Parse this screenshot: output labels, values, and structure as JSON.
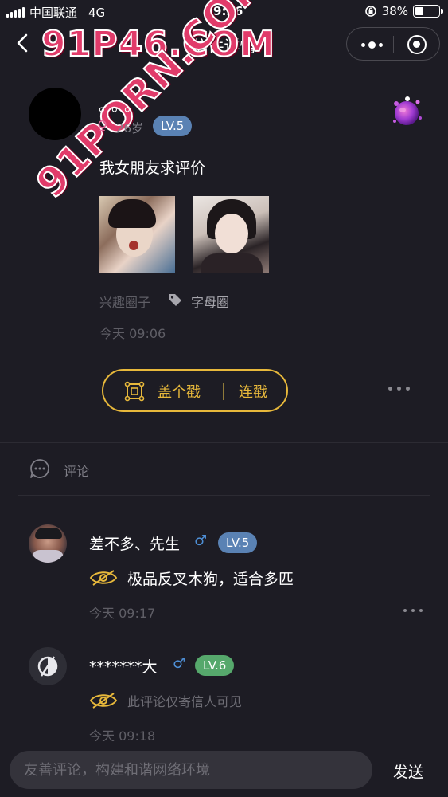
{
  "status_bar": {
    "carrier": "中国联通",
    "network": "4G",
    "time": "09:26",
    "battery": "38%",
    "battery_level": 0.38
  },
  "nav": {
    "title": "信件详情"
  },
  "watermark": {
    "top": "91P46.COM",
    "diagonal": "91PORN.COM"
  },
  "post": {
    "author": "。。。",
    "gender": "♀",
    "age": "26岁",
    "level": "LV.5",
    "text": "我女朋友求评价",
    "images": [
      "photo-1",
      "photo-2"
    ],
    "circle": "兴趣圈子",
    "tag": "字母圈",
    "time": "今天 09:06"
  },
  "actions": {
    "stamp": "盖个戳",
    "combo": "连戳"
  },
  "comments_section": {
    "title": "评论"
  },
  "comments": [
    {
      "name": "差不多、先生",
      "gender": "♂",
      "level": "LV.5",
      "text": "极品反叉木狗，适合多匹",
      "time": "今天 09:17"
    },
    {
      "name": "*******大",
      "gender": "♂",
      "level": "LV.6",
      "text": "此评论仅寄信人可见",
      "time": "今天 09:18"
    }
  ],
  "input_bar": {
    "placeholder": "友善评论，构建和谐网络环境",
    "send": "发送"
  },
  "colors": {
    "background": "#1d1c24",
    "accent_gold": "#e7b83b",
    "level_blue": "#5a82b4",
    "level_green": "#56a86c",
    "female_pink": "#e36b9b",
    "male_blue": "#4e8fd6"
  }
}
